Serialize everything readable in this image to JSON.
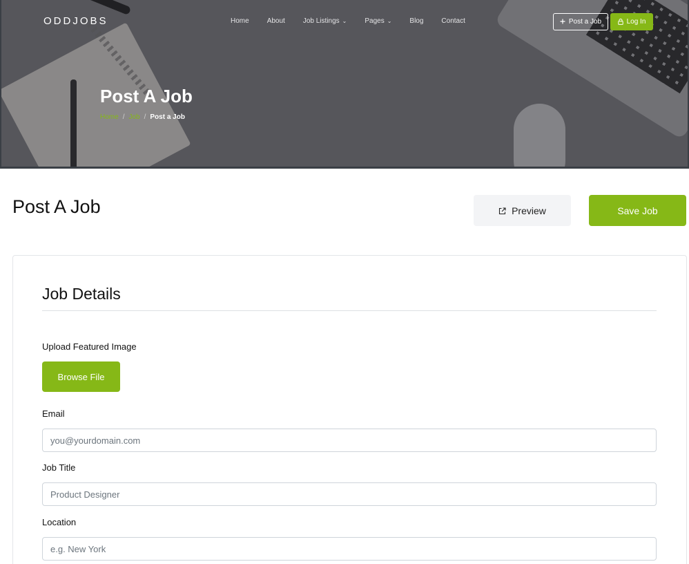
{
  "header": {
    "brand": "ODDJOBS",
    "nav": [
      {
        "label": "Home",
        "has_dropdown": false
      },
      {
        "label": "About",
        "has_dropdown": false
      },
      {
        "label": "Job Listings",
        "has_dropdown": true
      },
      {
        "label": "Pages",
        "has_dropdown": true
      },
      {
        "label": "Blog",
        "has_dropdown": false
      },
      {
        "label": "Contact",
        "has_dropdown": false
      }
    ],
    "post_job_label": "Post a Job",
    "login_label": "Log In",
    "post_job_icon": "plus-icon",
    "login_icon": "lock-icon"
  },
  "hero": {
    "title": "Post A Job",
    "breadcrumb": [
      "Home",
      "Job",
      "Post a Job"
    ],
    "breadcrumb_separator": "/"
  },
  "main": {
    "page_title": "Post A Job",
    "preview_label": "Preview",
    "preview_icon": "external-link-icon",
    "save_label": "Save Job"
  },
  "form": {
    "section_title": "Job Details",
    "upload_label": "Upload Featured Image",
    "browse_label": "Browse File",
    "email_label": "Email",
    "email_placeholder": "you@yourdomain.com",
    "job_title_label": "Job Title",
    "job_title_placeholder": "Product Designer",
    "location_label": "Location",
    "location_placeholder": "e.g. New York"
  },
  "colors": {
    "accent": "#86b817",
    "text": "#111111",
    "border": "#ced4da"
  }
}
